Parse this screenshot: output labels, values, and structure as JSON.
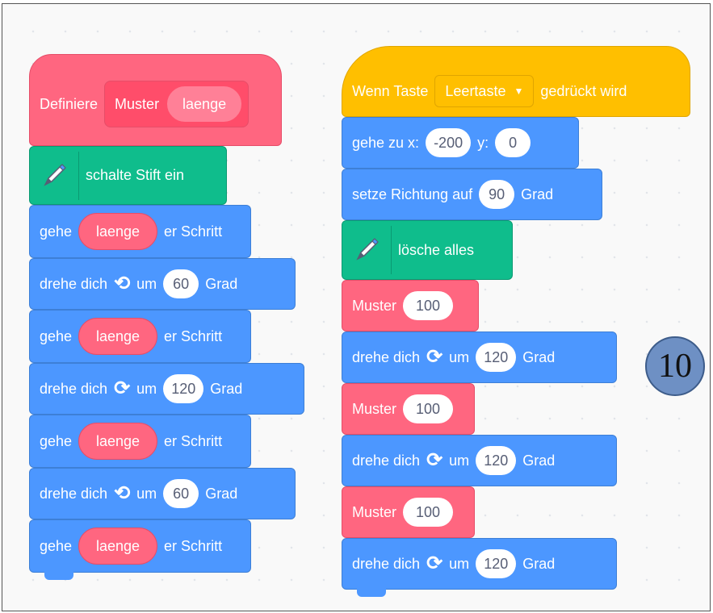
{
  "left_script": {
    "define": {
      "prefix": "Definiere",
      "name": "Muster",
      "param": "laenge"
    },
    "pen_down": {
      "label": "schalte Stift ein"
    },
    "move1": {
      "pre": "gehe",
      "param": "laenge",
      "post": "er Schritt"
    },
    "turn1": {
      "pre": "drehe dich",
      "um": "um",
      "value": "60",
      "unit": "Grad"
    },
    "move2": {
      "pre": "gehe",
      "param": "laenge",
      "post": "er Schritt"
    },
    "turn2": {
      "pre": "drehe dich",
      "um": "um",
      "value": "120",
      "unit": "Grad"
    },
    "move3": {
      "pre": "gehe",
      "param": "laenge",
      "post": "er Schritt"
    },
    "turn3": {
      "pre": "drehe dich",
      "um": "um",
      "value": "60",
      "unit": "Grad"
    },
    "move4": {
      "pre": "gehe",
      "param": "laenge",
      "post": "er Schritt"
    }
  },
  "right_script": {
    "hat": {
      "pre": "Wenn Taste",
      "key": "Leertaste",
      "post": "gedrückt wird"
    },
    "goto": {
      "label": "gehe zu x:",
      "x": "-200",
      "ylabel": "y:",
      "y": "0"
    },
    "direction": {
      "label": "setze Richtung auf",
      "value": "90",
      "unit": "Grad"
    },
    "clear": {
      "label": "lösche alles"
    },
    "call1": {
      "name": "Muster",
      "value": "100"
    },
    "turn1": {
      "pre": "drehe dich",
      "um": "um",
      "value": "120",
      "unit": "Grad"
    },
    "call2": {
      "name": "Muster",
      "value": "100"
    },
    "turn2": {
      "pre": "drehe dich",
      "um": "um",
      "value": "120",
      "unit": "Grad"
    },
    "call3": {
      "name": "Muster",
      "value": "100"
    },
    "turn3": {
      "pre": "drehe dich",
      "um": "um",
      "value": "120",
      "unit": "Grad"
    }
  },
  "badge": {
    "number": "10"
  },
  "icons": {
    "pen": "pen-icon",
    "turn_left": "rotate-left-icon",
    "turn_right": "rotate-right-icon",
    "dropdown": "caret-down-icon"
  },
  "colors": {
    "motion": "#4c97ff",
    "pen": "#0fbd8c",
    "custom": "#ff6680",
    "event": "#ffbf00"
  }
}
